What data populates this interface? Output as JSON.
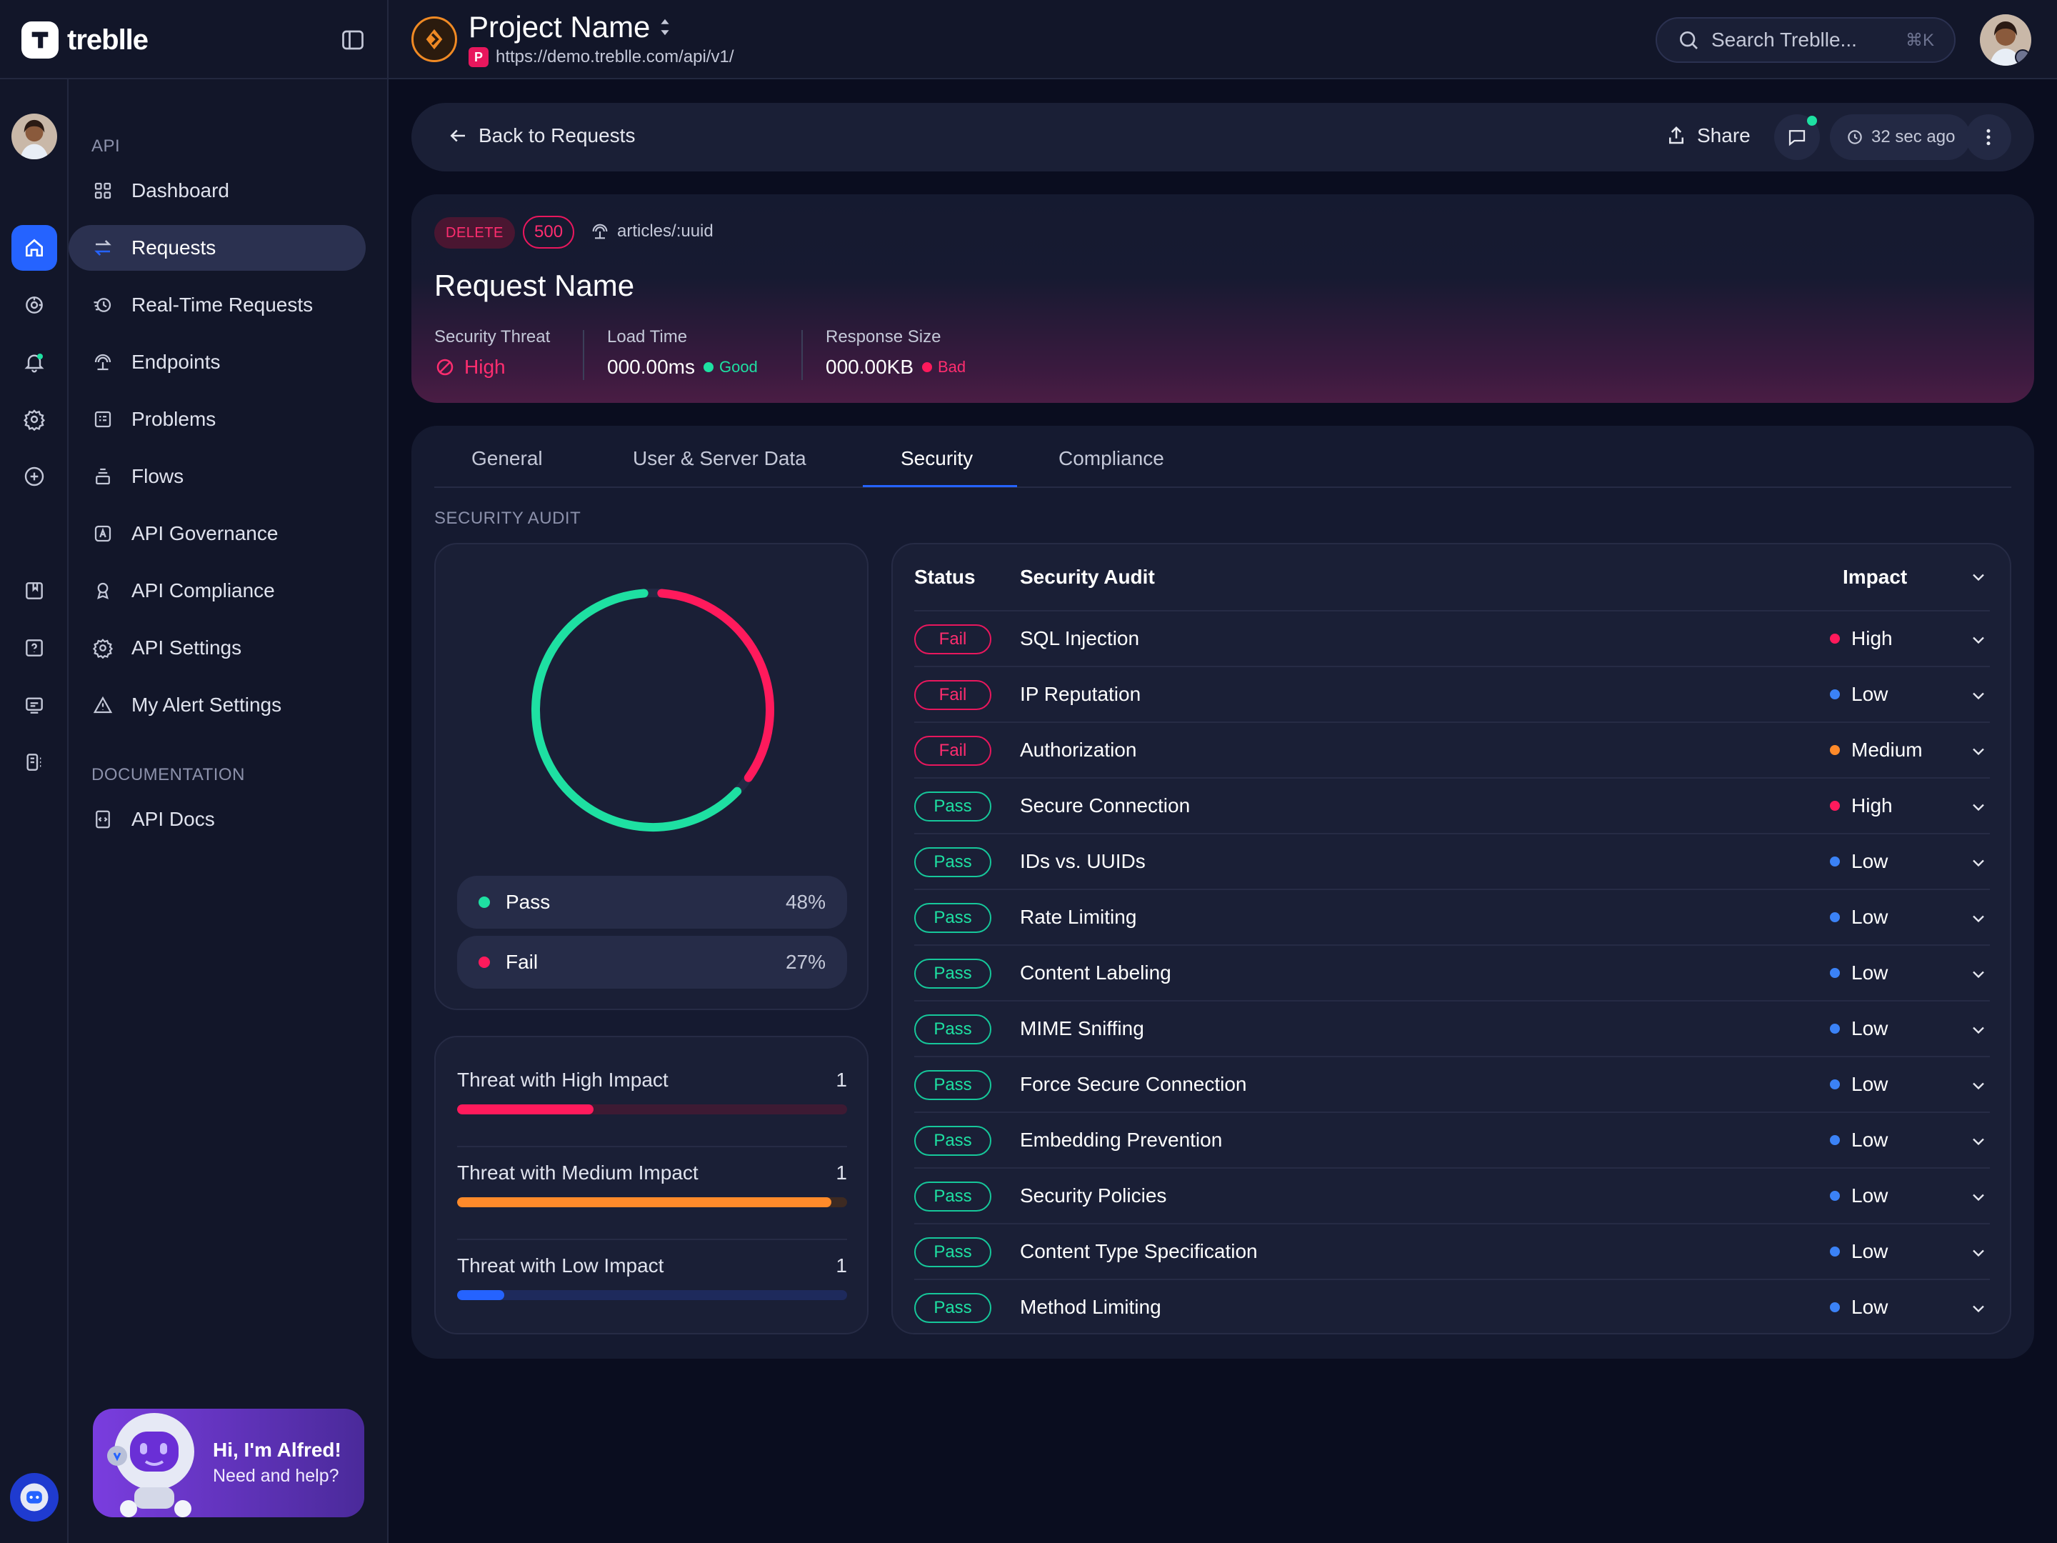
{
  "brand": {
    "name": "treblle"
  },
  "project": {
    "name": "Project Name",
    "url_badge": "P",
    "url": "https://demo.treblle.com/api/v1/"
  },
  "search": {
    "placeholder": "Search Treblle...",
    "shortcut": "⌘K"
  },
  "nav": {
    "section_api": "API",
    "items": [
      {
        "label": "Dashboard",
        "icon": "grid-icon"
      },
      {
        "label": "Requests",
        "icon": "arrows-icon"
      },
      {
        "label": "Real-Time Requests",
        "icon": "realtime-icon"
      },
      {
        "label": "Endpoints",
        "icon": "endpoints-icon"
      },
      {
        "label": "Problems",
        "icon": "problems-icon"
      },
      {
        "label": "Flows",
        "icon": "flows-icon"
      },
      {
        "label": "API Governance",
        "icon": "governance-icon"
      },
      {
        "label": "API Compliance",
        "icon": "compliance-icon"
      },
      {
        "label": "API Settings",
        "icon": "gear-icon"
      },
      {
        "label": "My Alert Settings",
        "icon": "alert-icon"
      }
    ],
    "section_docs": "DOCUMENTATION",
    "docs_items": [
      {
        "label": "API Docs",
        "icon": "docs-icon"
      }
    ]
  },
  "alfred": {
    "title": "Hi, I'm Alfred!",
    "subtitle": "Need and help?"
  },
  "toolbar": {
    "back_label": "Back to Requests",
    "share_label": "Share",
    "time_label": "32 sec ago"
  },
  "request": {
    "method": "DELETE",
    "status_code": "500",
    "route": "articles/:uuid",
    "name": "Request Name",
    "security_threat": {
      "label": "Security Threat",
      "value": "High"
    },
    "load_time": {
      "label": "Load Time",
      "value": "000.00ms",
      "rating": "Good"
    },
    "response_size": {
      "label": "Response Size",
      "value": "000.00KB",
      "rating": "Bad"
    }
  },
  "tabs": [
    "General",
    "User & Server Data",
    "Security",
    "Compliance"
  ],
  "active_tab": "Security",
  "security_audit_label": "SECURITY AUDIT",
  "summary": {
    "pass": {
      "label": "Pass",
      "percent": "48%",
      "value": 48
    },
    "fail": {
      "label": "Fail",
      "percent": "27%",
      "value": 27
    }
  },
  "threats": [
    {
      "label": "Threat with High Impact",
      "count": "1",
      "level": 0.35,
      "color": "#ff1a5c",
      "track": "#3d1a33"
    },
    {
      "label": "Threat with Medium Impact",
      "count": "1",
      "level": 0.96,
      "color": "#ff8a2a",
      "track": "#3d2a22"
    },
    {
      "label": "Threat with Low Impact",
      "count": "1",
      "level": 0.12,
      "color": "#2563ff",
      "track": "#1e2a5c"
    }
  ],
  "table": {
    "headers": {
      "status": "Status",
      "audit": "Security Audit",
      "impact": "Impact"
    },
    "rows": [
      {
        "status": "Fail",
        "name": "SQL Injection",
        "impact": "High"
      },
      {
        "status": "Fail",
        "name": "IP Reputation",
        "impact": "Low"
      },
      {
        "status": "Fail",
        "name": "Authorization",
        "impact": "Medium"
      },
      {
        "status": "Pass",
        "name": "Secure Connection",
        "impact": "High"
      },
      {
        "status": "Pass",
        "name": "IDs vs. UUIDs",
        "impact": "Low"
      },
      {
        "status": "Pass",
        "name": "Rate Limiting",
        "impact": "Low"
      },
      {
        "status": "Pass",
        "name": "Content Labeling",
        "impact": "Low"
      },
      {
        "status": "Pass",
        "name": "MIME Sniffing",
        "impact": "Low"
      },
      {
        "status": "Pass",
        "name": "Force Secure Connection",
        "impact": "Low"
      },
      {
        "status": "Pass",
        "name": "Embedding Prevention",
        "impact": "Low"
      },
      {
        "status": "Pass",
        "name": "Security Policies",
        "impact": "Low"
      },
      {
        "status": "Pass",
        "name": "Content Type Specification",
        "impact": "Low"
      },
      {
        "status": "Pass",
        "name": "Method Limiting",
        "impact": "Low"
      }
    ]
  },
  "colors": {
    "accent": "#2563ff",
    "pass": "#1ee0a2",
    "fail": "#ff1a5c",
    "impact_high": "#ff1a5c",
    "impact_medium": "#ff8a2a",
    "impact_low": "#3b82f6"
  }
}
